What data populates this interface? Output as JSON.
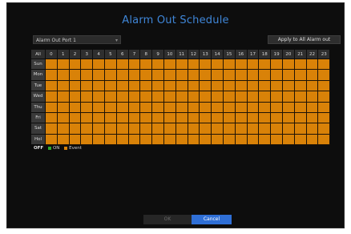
{
  "dialog": {
    "title": "Alarm Out Schedule",
    "port_select": "Alarm Out Port 1",
    "apply_button": "Apply to All Alarm out"
  },
  "grid": {
    "corner": "All",
    "hours": [
      "0",
      "1",
      "2",
      "3",
      "4",
      "5",
      "6",
      "7",
      "8",
      "9",
      "10",
      "11",
      "12",
      "13",
      "14",
      "15",
      "16",
      "17",
      "18",
      "19",
      "20",
      "21",
      "22",
      "23"
    ],
    "days": [
      "Sun",
      "Mon",
      "Tue",
      "Wed",
      "Thu",
      "Fri",
      "Sat",
      "Hol"
    ],
    "cell_state": "Event"
  },
  "legend": {
    "off": "OFF",
    "on": "ON",
    "event": "Event",
    "on_color": "#2fa82f",
    "event_color": "#d98208"
  },
  "buttons": {
    "ok": "OK",
    "cancel": "Cancel"
  }
}
